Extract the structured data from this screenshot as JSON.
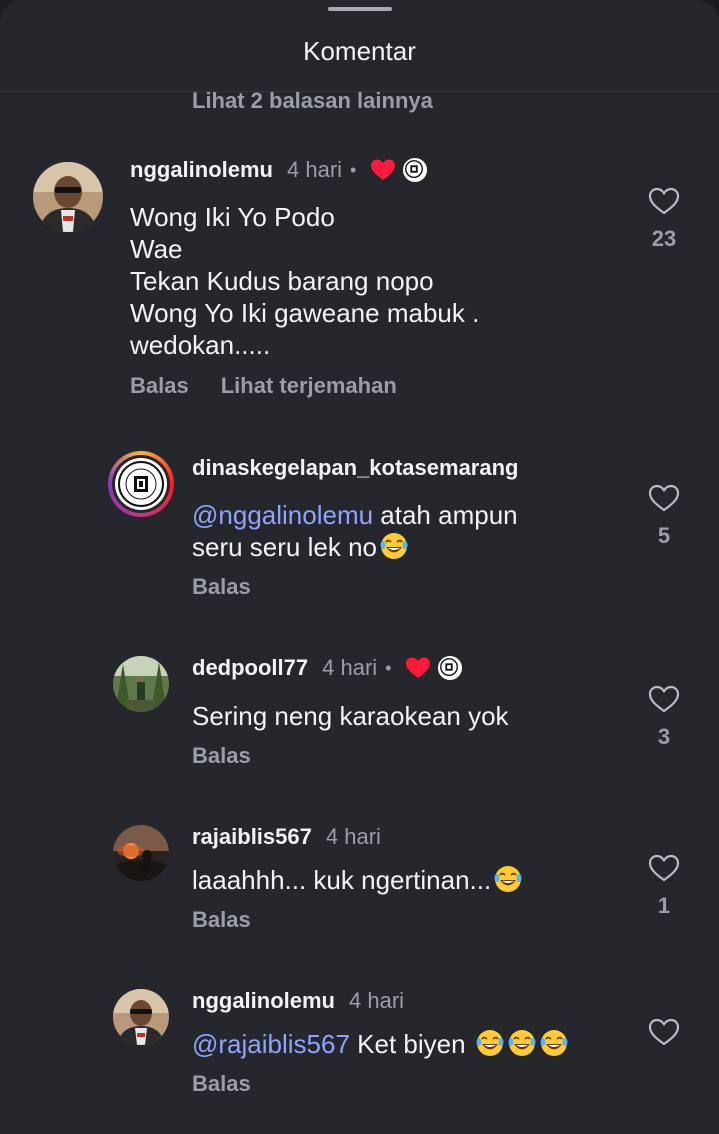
{
  "sheet": {
    "title": "Komentar",
    "more_replies": "Lihat 2 balasan lainnya"
  },
  "colors": {
    "background": "#25272c",
    "muted_text": "#9a9ea6",
    "mention": "#8fa3ff",
    "liked_heart": "#ff1a3c"
  },
  "comments": [
    {
      "username": "nggalinolemu",
      "time": "4 hari",
      "dot": "•",
      "creator_liked": true,
      "text": "Wong Iki Yo Podo\nWae\nTekan Kudus barang nopo\nWong Yo Iki gaweane mabuk .\nwedokan.....",
      "reply_label": "Balas",
      "translate_label": "Lihat terjemahan",
      "likes": "23",
      "avatar_icon": "person-sunglasses-avatar"
    },
    {
      "username": "dinaskegelapan_kotasemarang",
      "mention": "@nggalinolemu",
      "text": " atah ampun\nseru seru lek no",
      "emoji": "laughing-tears",
      "reply_label": "Balas",
      "likes": "5",
      "avatar_icon": "city-seal-avatar"
    },
    {
      "username": "dedpooll77",
      "time": "4 hari",
      "dot": "•",
      "creator_liked": true,
      "text": "Sering neng karaokean yok",
      "reply_label": "Balas",
      "likes": "3",
      "avatar_icon": "forest-person-avatar"
    },
    {
      "username": "rajaiblis567",
      "time": "4 hari",
      "text": "laaahhh... kuk ngertinan...",
      "emoji": "laughing-tears",
      "reply_label": "Balas",
      "likes": "1",
      "avatar_icon": "sunset-silhouette-avatar"
    },
    {
      "username": "nggalinolemu",
      "time": "4 hari",
      "mention": "@rajaiblis567",
      "text": " Ket biyen ",
      "emoji_count": 3,
      "reply_label": "Balas",
      "likes": "",
      "avatar_icon": "person-sunglasses-avatar"
    }
  ]
}
